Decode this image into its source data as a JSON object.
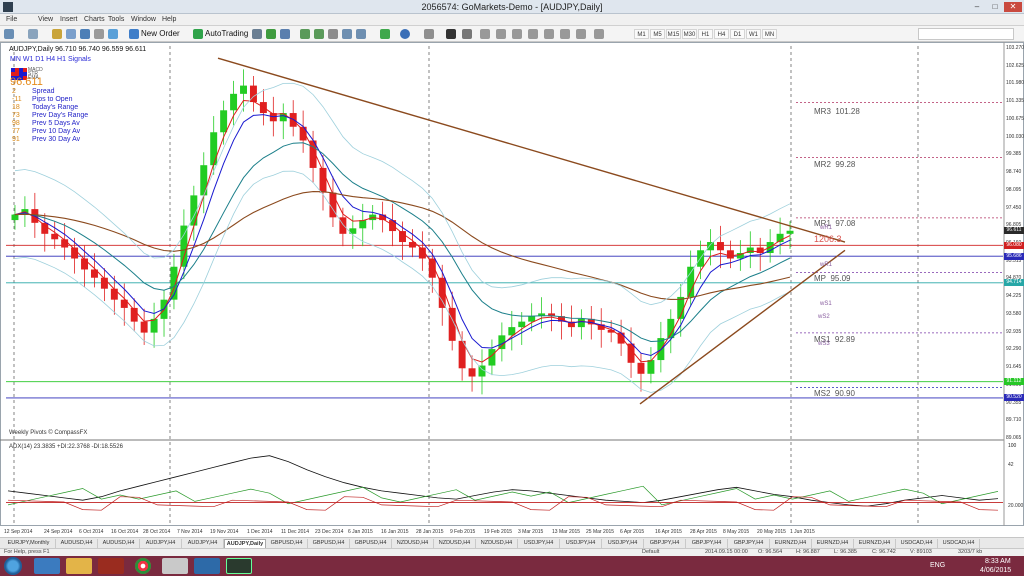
{
  "window": {
    "title": "2056574: GoMarkets-Demo - [AUDJPY,Daily]",
    "minimize": "–",
    "maximize": "□",
    "close": "✕"
  },
  "menu": [
    "File",
    "View",
    "Insert",
    "Charts",
    "Tools",
    "Window",
    "Help"
  ],
  "toolbar": {
    "new_order": "New Order",
    "autotrading": "AutoTrading",
    "timeframes": [
      "M1",
      "M5",
      "M15",
      "M30",
      "H1",
      "H4",
      "D1",
      "W1",
      "MN"
    ]
  },
  "chart": {
    "symbol_line": "AUDJPY,Daily  96.710 96.740 96.559 96.611",
    "signal_title": "MN  W1  D1  H4  H1 Signals",
    "indicator_keys": [
      "MACD",
      "STR",
      "EMA"
    ],
    "current_price": "96.611",
    "stats": [
      {
        "value": "2",
        "label": "Spread"
      },
      {
        "value": "-11",
        "label": "Pips to Open"
      },
      {
        "value": "18",
        "label": "Today's Range"
      },
      {
        "value": "73",
        "label": "Prev Day's Range"
      },
      {
        "value": "98",
        "label": "Prev 5 Days Av"
      },
      {
        "value": "77",
        "label": "Prev 10 Day Av"
      },
      {
        "value": "91",
        "label": "Prev 30 Day Av"
      }
    ],
    "pivots": [
      {
        "label": "MR3",
        "value": "101.28"
      },
      {
        "label": "MR2",
        "value": "99.28"
      },
      {
        "label": "MR1",
        "value": "97.08"
      },
      {
        "label": "MP",
        "value": "95.09"
      },
      {
        "label": "MS1",
        "value": "92.89"
      },
      {
        "label": "MS2",
        "value": "90.90"
      }
    ],
    "weekly_small": [
      "wR1",
      "wR1",
      "wS1",
      "wS2",
      "wS3"
    ],
    "counter_label": "1206.3",
    "weekly_pivots_source": "Weekly Pivots © CompassFX",
    "adx_label": "ADX(14) 23.3835 +DI:22.3768 -DI:18.5526",
    "colors": {
      "candle_up": "#22cc22",
      "candle_down": "#e02020",
      "ema_fast_red": "#e01b1b",
      "ema_mid_blue": "#1a1ad0",
      "ema_slow_teal": "#1b7f8a",
      "ema_200_brown": "#8b4a1e",
      "bollinger": "#9ed0dc",
      "trendline": "#8b4a1e",
      "hline_green": "#27c727",
      "hline_red": "#d02020",
      "hline_blue": "#2a2ab8"
    }
  },
  "chart_data": {
    "type": "candlestick",
    "title": "AUDJPY,Daily",
    "y_range": [
      89.06,
      103.27
    ],
    "x_dates": [
      "12 Sep 2014",
      "24 Sep 2014",
      "6 Oct 2014",
      "16 Oct 2014",
      "28 Oct 2014",
      "7 Nov 2014",
      "19 Nov 2014",
      "1 Dec 2014",
      "11 Dec 2014",
      "23 Dec 2014",
      "6 Jan 2015",
      "16 Jan 2015",
      "28 Jan 2015",
      "9 Feb 2015",
      "19 Feb 2015",
      "3 Mar 2015",
      "13 Mar 2015",
      "25 Mar 2015",
      "6 Apr 2015",
      "16 Apr 2015",
      "28 Apr 2015",
      "8 May 2015",
      "20 May 2015",
      "1 Jun 2015"
    ],
    "price_ticks": [
      "103.270",
      "102.625",
      "101.980",
      "101.335",
      "100.675",
      "100.030",
      "99.385",
      "98.740",
      "98.095",
      "97.450",
      "96.805",
      "96.160",
      "95.515",
      "94.870",
      "94.225",
      "93.580",
      "92.935",
      "92.290",
      "91.645",
      "91.000",
      "90.355",
      "89.710",
      "89.065"
    ],
    "price_tags": [
      {
        "text": "96.611",
        "color": "#2a2a2a"
      },
      {
        "text": "96.080",
        "color": "#d02020"
      },
      {
        "text": "95.686",
        "color": "#2a2ab8"
      },
      {
        "text": "94.714",
        "color": "#27a7a7"
      },
      {
        "text": "91.112",
        "color": "#27c727"
      },
      {
        "text": "90.520",
        "color": "#2a2ab8"
      }
    ],
    "candle_closes": [
      97.2,
      97.4,
      96.9,
      96.5,
      96.3,
      96.0,
      95.6,
      95.2,
      94.9,
      94.5,
      94.1,
      93.8,
      93.3,
      92.9,
      93.4,
      94.1,
      95.3,
      96.8,
      97.9,
      99.0,
      100.2,
      101.0,
      101.6,
      101.9,
      101.3,
      100.9,
      100.6,
      100.9,
      100.4,
      99.9,
      98.9,
      98.0,
      97.1,
      96.5,
      96.7,
      97.0,
      97.2,
      97.0,
      96.6,
      96.2,
      96.0,
      95.6,
      94.9,
      93.8,
      92.6,
      91.6,
      91.3,
      91.7,
      92.3,
      92.8,
      93.1,
      93.3,
      93.5,
      93.6,
      93.5,
      93.3,
      93.1,
      93.4,
      93.2,
      93.0,
      92.9,
      92.5,
      91.8,
      91.4,
      91.9,
      92.7,
      93.4,
      94.2,
      95.3,
      95.9,
      96.2,
      95.9,
      95.6,
      95.8,
      96.0,
      95.8,
      96.2,
      96.5,
      96.611
    ],
    "hlines": [
      {
        "name": "red",
        "value": 96.08
      },
      {
        "name": "blue",
        "value": 95.686
      },
      {
        "name": "teal",
        "value": 94.714
      },
      {
        "name": "green",
        "value": 91.112
      },
      {
        "name": "blue2",
        "value": 90.52
      }
    ],
    "pivot_values": {
      "MR3": 101.28,
      "MR2": 99.28,
      "MR1": 97.08,
      "MP": 95.09,
      "MS1": 92.89,
      "MS2": 90.9
    },
    "adx_ticks": [
      "100",
      "42",
      "20.000"
    ],
    "adx": [
      30,
      28,
      26,
      24,
      22,
      25,
      30,
      34,
      38,
      42,
      46,
      50,
      54,
      58,
      60,
      55,
      48,
      42,
      37,
      33,
      30,
      28,
      26,
      24,
      23,
      26,
      29,
      31,
      30,
      28,
      26,
      24,
      22,
      21,
      20,
      22,
      25,
      28,
      31,
      33,
      30,
      27,
      25,
      22,
      20,
      18,
      17,
      19,
      22,
      24,
      26,
      24,
      22,
      23.38
    ]
  },
  "tabs": [
    "EURJPY,Monthly",
    "AUDUSD,H4",
    "AUDUSD,H4",
    "AUDJPY,H4",
    "AUDJPY,H4",
    "AUDJPY,Daily",
    "GBPUSD,H4",
    "GBPUSD,H4",
    "GBPUSD,H4",
    "NZDUSD,H4",
    "NZDUSD,H4",
    "NZDUSD,H4",
    "USDJPY,H4",
    "USDJPY,H4",
    "USDJPY,H4",
    "GBPJPY,H4",
    "GBPJPY,H4",
    "GBPJPY,H4",
    "EURNZD,H4",
    "EURNZD,H4",
    "EURNZD,H4",
    "USDCAD,H4",
    "USDCAD,H4"
  ],
  "active_tab": "AUDJPY,Daily",
  "status": {
    "help": "For Help, press F1",
    "profile": "Default",
    "datetime": "2014.09.15 00:00",
    "o": "O: 96.564",
    "h": "H: 96.887",
    "l": "L: 96.385",
    "c": "C: 96.742",
    "v": "V: 89103",
    "traffic": "3203/7 kb"
  },
  "tray": {
    "lang": "ENG",
    "time": "8:33 AM",
    "date": "4/06/2015"
  }
}
